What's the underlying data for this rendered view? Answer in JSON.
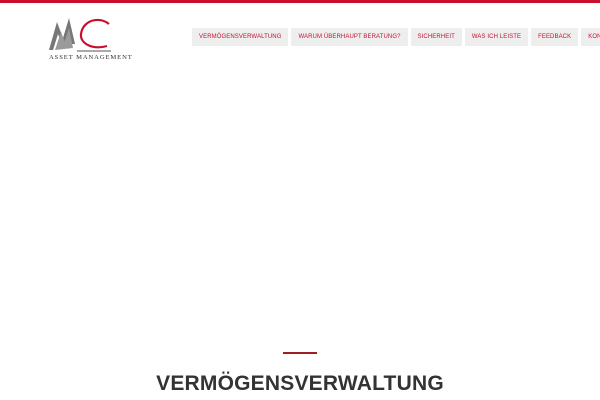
{
  "header": {
    "logo_text": "ASSET MANAGEMENT",
    "accent_color": "#c8102e"
  },
  "nav": {
    "items": [
      {
        "label": "VERMÖGENSVERWALTUNG"
      },
      {
        "label": "WARUM ÜBERHAUPT BERATUNG?"
      },
      {
        "label": "SICHERHEIT"
      },
      {
        "label": "WAS ICH LEISTE"
      },
      {
        "label": "FEEDBACK"
      },
      {
        "label": "KONTAKT"
      }
    ]
  },
  "main": {
    "title": "VERMÖGENSVERWALTUNG"
  }
}
